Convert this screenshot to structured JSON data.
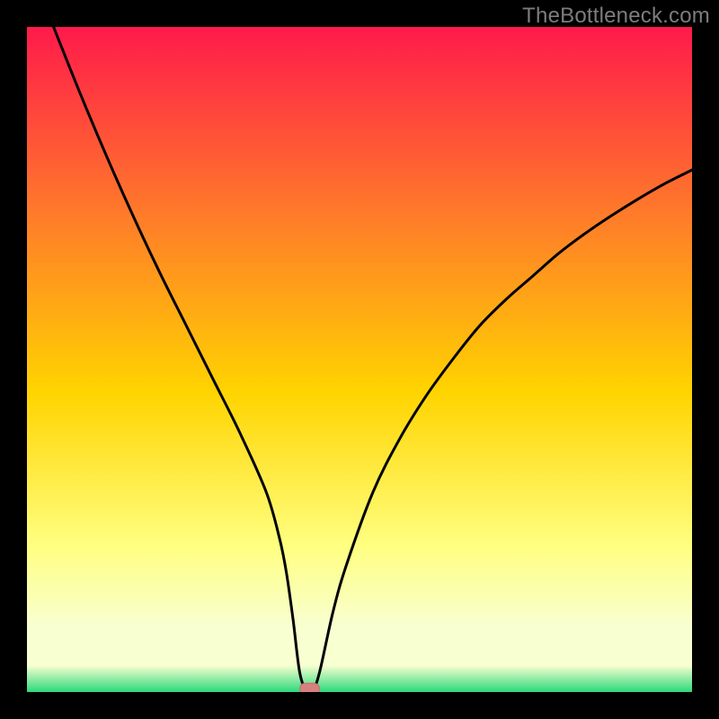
{
  "watermark": "TheBottleneck.com",
  "colors": {
    "frame": "#000000",
    "gradient_top": "#ff1a4b",
    "gradient_mid1": "#ff7a2a",
    "gradient_mid2": "#ffd400",
    "gradient_low1": "#ffff80",
    "gradient_low2": "#f8ffd0",
    "gradient_bottom": "#2bd97b",
    "curve": "#000000",
    "marker_fill": "#d6817f",
    "marker_stroke": "#c86b69"
  },
  "chart_data": {
    "type": "line",
    "title": "",
    "xlabel": "",
    "ylabel": "",
    "xlim": [
      0,
      100
    ],
    "ylim": [
      0,
      100
    ],
    "series": [
      {
        "name": "bottleneck-curve",
        "x": [
          4,
          8,
          12,
          16,
          20,
          24,
          28,
          32,
          36,
          38,
          39,
          40,
          41,
          42,
          43,
          44,
          46,
          48,
          52,
          56,
          60,
          64,
          68,
          72,
          76,
          80,
          84,
          88,
          92,
          96,
          100
        ],
        "y": [
          100,
          90,
          80.5,
          71.5,
          63,
          55,
          47,
          39,
          30,
          23,
          18,
          11,
          3,
          0.3,
          0.3,
          3,
          12,
          19,
          30,
          38,
          44.5,
          50,
          55,
          59,
          62.5,
          66,
          69,
          71.7,
          74.2,
          76.5,
          78.5
        ]
      }
    ],
    "marker": {
      "x": 42.5,
      "y": 0.5,
      "label": "optimal-point"
    },
    "gradient_stops_pct": [
      0,
      28,
      55,
      78,
      90,
      96,
      100
    ]
  }
}
